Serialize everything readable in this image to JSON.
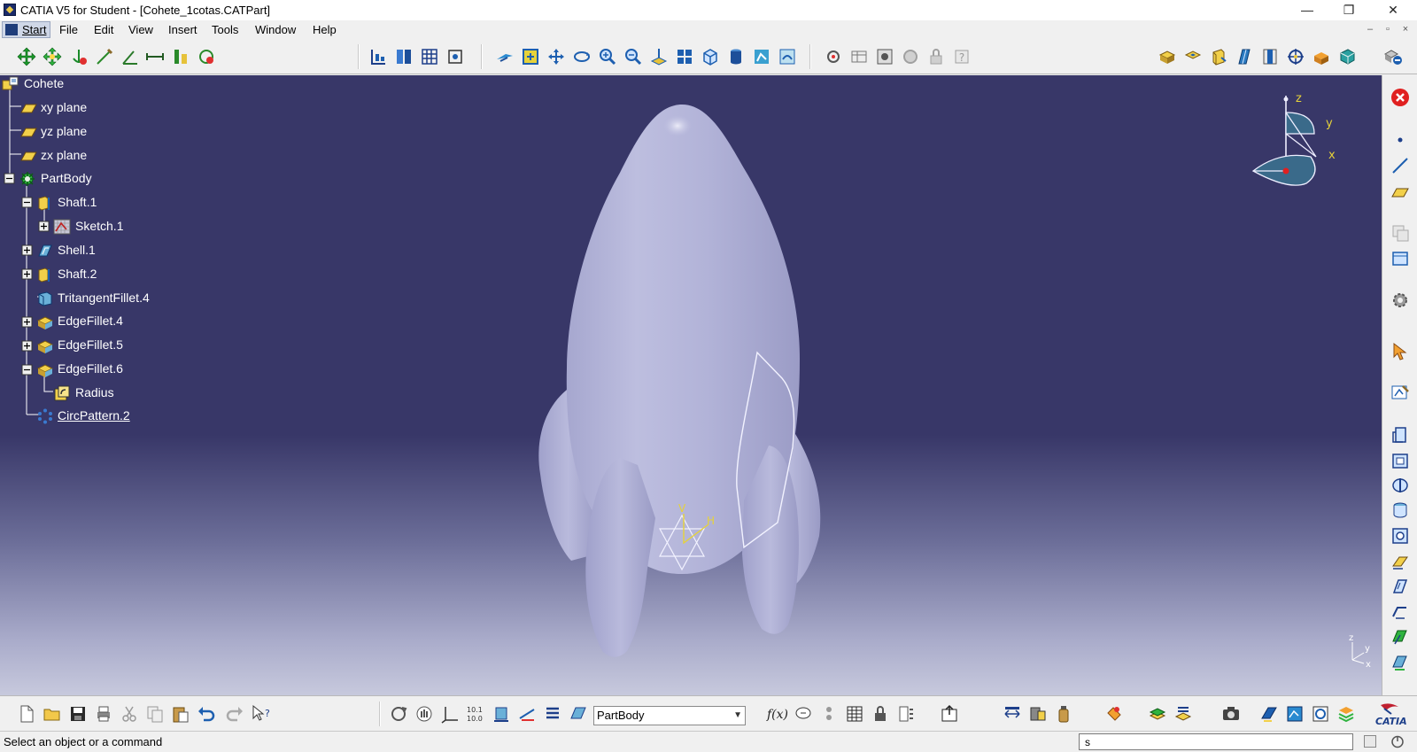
{
  "window": {
    "title": "CATIA V5 for Student - [Cohete_1cotas.CATPart]",
    "controls": {
      "minimize": "—",
      "maximize": "❐",
      "close": "✕"
    }
  },
  "menubar": {
    "items": [
      "Start",
      "File",
      "Edit",
      "View",
      "Insert",
      "Tools",
      "Window",
      "Help"
    ],
    "mdi_controls": {
      "minimize": "–",
      "restore": "▫",
      "close": "×"
    }
  },
  "tree": {
    "root": "Cohete",
    "nodes": [
      {
        "label": "xy plane",
        "icon": "plane-icon"
      },
      {
        "label": "yz plane",
        "icon": "plane-icon"
      },
      {
        "label": "zx plane",
        "icon": "plane-icon"
      },
      {
        "label": "PartBody",
        "icon": "partbody-icon"
      },
      {
        "label": "Shaft.1",
        "icon": "shaft-icon"
      },
      {
        "label": "Sketch.1",
        "icon": "sketch-icon"
      },
      {
        "label": "Shell.1",
        "icon": "shell-icon"
      },
      {
        "label": "Shaft.2",
        "icon": "shaft-icon"
      },
      {
        "label": "TritangentFillet.4",
        "icon": "tritangent-fillet-icon"
      },
      {
        "label": "EdgeFillet.4",
        "icon": "edge-fillet-icon"
      },
      {
        "label": "EdgeFillet.5",
        "icon": "edge-fillet-icon"
      },
      {
        "label": "EdgeFillet.6",
        "icon": "edge-fillet-icon"
      },
      {
        "label": "Radius",
        "icon": "radius-parameter-icon"
      },
      {
        "label": "CircPattern.2",
        "icon": "circular-pattern-icon"
      }
    ]
  },
  "viewport": {
    "model_name": "rocket-part",
    "compass_axes": {
      "z": "z",
      "y": "y",
      "x": "x"
    },
    "sketch_axes": {
      "v": "V",
      "h": "H"
    },
    "mini_axes": {
      "z": "z",
      "y": "y",
      "x": "x"
    }
  },
  "bottom_toolbar": {
    "current_body": "PartBody"
  },
  "status": {
    "message": "Select an object or a command",
    "command_input": "s"
  },
  "colors": {
    "background_top": "#383768",
    "background_bottom": "#c7c9dd",
    "model": "#b4b5d8",
    "tree_text": "#ffffff",
    "toolbar": "#f0f0f0"
  }
}
